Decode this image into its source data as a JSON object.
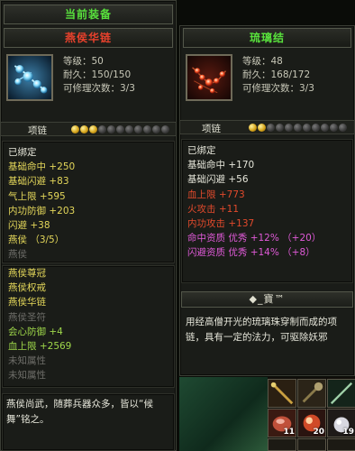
{
  "title": "当前装备",
  "left": {
    "name": "燕侯华链",
    "level": "等级：50",
    "durability": "耐久：150/150",
    "repairs": "可修理次数：3/3",
    "type": "项链",
    "stars": 3,
    "stars_total": 11,
    "lines_a": [
      {
        "t": "已绑定",
        "c": "white"
      },
      {
        "t": "基础命中 ",
        "v": "+250",
        "c": "yellow"
      },
      {
        "t": "基础闪避 ",
        "v": "+83",
        "c": "yellow"
      },
      {
        "t": "气上限 ",
        "v": "+595",
        "c": "yellow"
      },
      {
        "t": "内功防御 ",
        "v": "+203",
        "c": "yellow"
      },
      {
        "t": "闪避 ",
        "v": "+38",
        "c": "yellow"
      },
      {
        "t": "燕侯 （3/5）",
        "c": "yellow"
      },
      {
        "t": "燕侯",
        "c": "gray"
      }
    ],
    "lines_b": [
      {
        "t": "燕侯尊冠",
        "c": "yellow"
      },
      {
        "t": "燕侯权戒",
        "c": "yellow"
      },
      {
        "t": "燕侯华链",
        "c": "yellow"
      },
      {
        "t": "燕侯圣符",
        "c": "gray"
      },
      {
        "t": "会心防御 ",
        "v": "+4",
        "c": "green"
      },
      {
        "t": "血上限 ",
        "v": "+2569",
        "c": "green"
      },
      {
        "t": "未知属性",
        "c": "gray"
      },
      {
        "t": "未知属性",
        "c": "gray"
      }
    ],
    "bottom_desc": "燕侯尚武，随葬兵器众多，皆以“候舞”铭之。"
  },
  "right": {
    "name": "琉璃结",
    "level": "等级：48",
    "durability": "耐久：168/172",
    "repairs": "可修理次数：3/3",
    "type": "项链",
    "stars": 2,
    "stars_total": 11,
    "lines": [
      {
        "t": "已绑定",
        "c": "white"
      },
      {
        "t": "基础命中 ",
        "v": "+170",
        "c": "white"
      },
      {
        "t": "基础闪避 ",
        "v": "+56",
        "c": "white"
      },
      {
        "t": "血上限 ",
        "v": "+773",
        "c": "red"
      },
      {
        "t": "火攻击 ",
        "v": "+11",
        "c": "red"
      },
      {
        "t": "内功攻击 ",
        "v": "+137",
        "c": "red"
      },
      {
        "t": "命中资质  优秀 ",
        "v": "+12% （+20）",
        "c": "pink"
      },
      {
        "t": "闪避资质  优秀 ",
        "v": "+14% （+8）",
        "c": "pink"
      }
    ],
    "sub_header": "◆_寶™",
    "desc": "用经高僧开光的琉璃珠穿制而成的项链，具有一定的法力，可驱除妖邪"
  },
  "inventory": {
    "counts": [
      "11",
      "20",
      "19"
    ]
  },
  "colors": {
    "white": "#e6e6da",
    "yellow": "#e4d75a",
    "green": "#9fd84a",
    "gray": "#6d6d68",
    "pink": "#e05ad8",
    "red": "#e34a2c"
  }
}
